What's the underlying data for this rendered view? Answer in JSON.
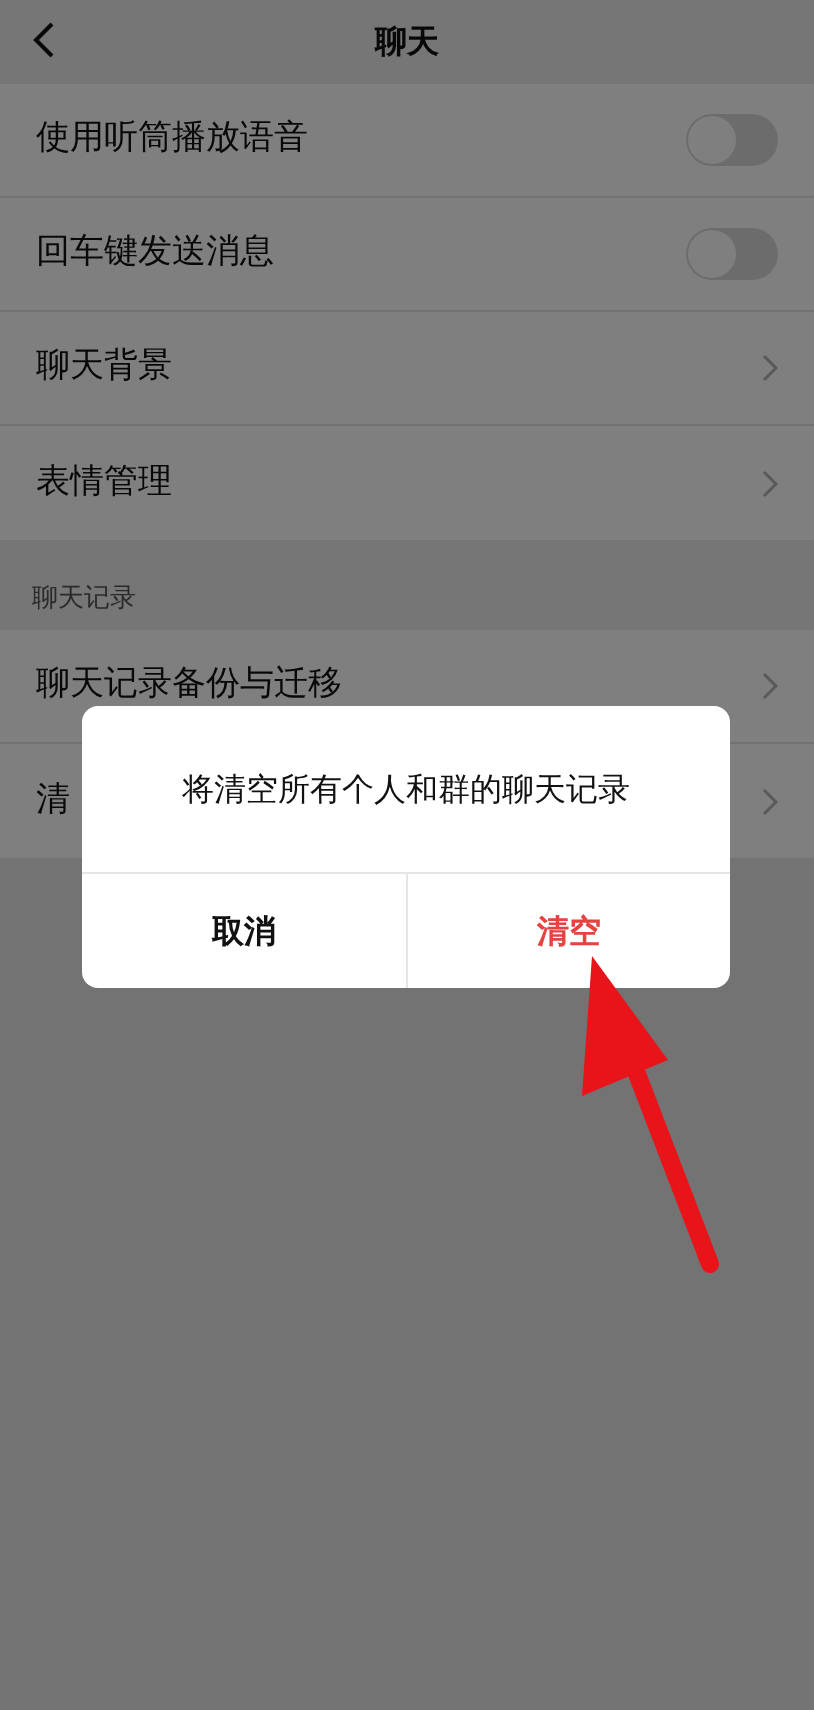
{
  "header": {
    "title": "聊天"
  },
  "settings": [
    {
      "label": "使用听筒播放语音",
      "kind": "toggle",
      "on": false
    },
    {
      "label": "回车键发送消息",
      "kind": "toggle",
      "on": false
    },
    {
      "label": "聊天背景",
      "kind": "link"
    },
    {
      "label": "表情管理",
      "kind": "link"
    }
  ],
  "history_section": {
    "title": "聊天记录",
    "items": [
      {
        "label": "聊天记录备份与迁移",
        "kind": "link"
      },
      {
        "label": "清",
        "kind": "link"
      }
    ]
  },
  "dialog": {
    "message": "将清空所有个人和群的聊天记录",
    "buttons": [
      {
        "label": "取消",
        "kind": "cancel"
      },
      {
        "label": "清空",
        "kind": "destructive"
      }
    ]
  }
}
